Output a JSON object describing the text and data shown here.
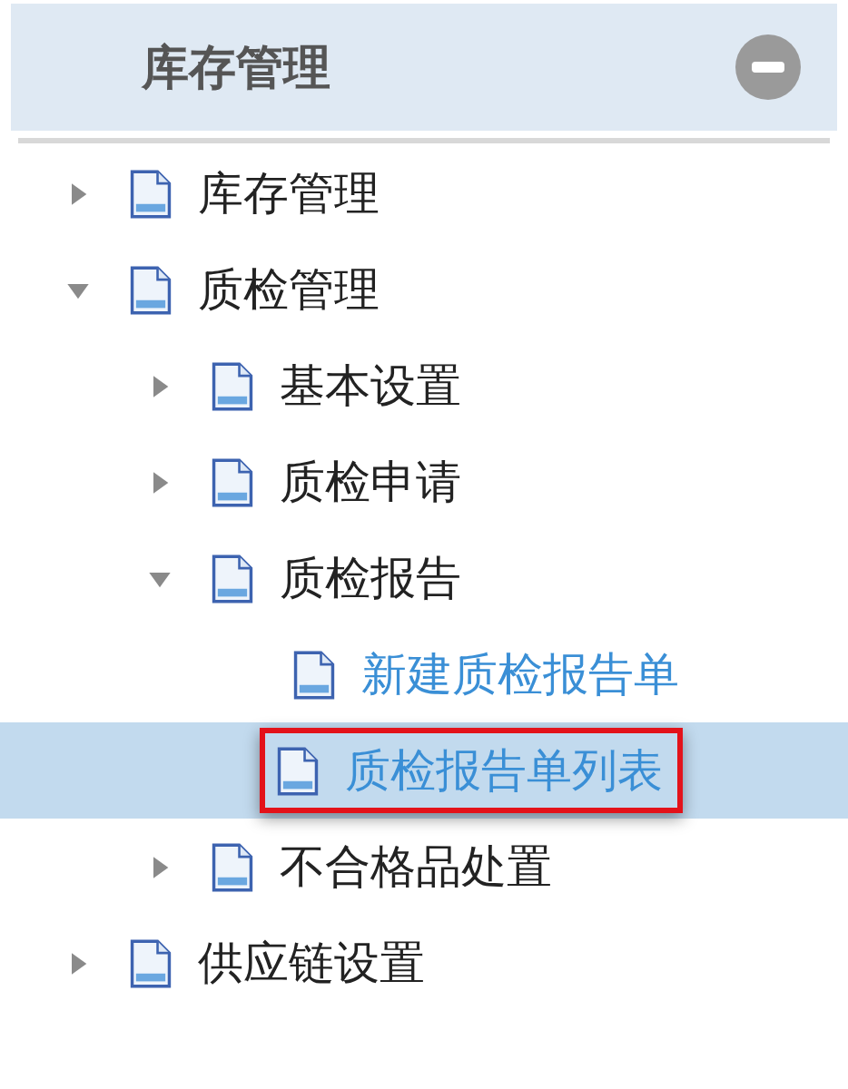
{
  "panel": {
    "title": "库存管理",
    "expanded": true
  },
  "tree": [
    {
      "label": "库存管理",
      "kind": "branch",
      "expanded": false,
      "selected": false
    },
    {
      "label": "质检管理",
      "kind": "branch",
      "expanded": true,
      "selected": false,
      "children": [
        {
          "label": "基本设置",
          "kind": "branch",
          "expanded": false,
          "selected": false
        },
        {
          "label": "质检申请",
          "kind": "branch",
          "expanded": false,
          "selected": false
        },
        {
          "label": "质检报告",
          "kind": "branch",
          "expanded": true,
          "selected": false,
          "children": [
            {
              "label": "新建质检报告单",
              "kind": "leaf",
              "selected": false
            },
            {
              "label": "质检报告单列表",
              "kind": "leaf",
              "selected": true
            }
          ]
        },
        {
          "label": "不合格品处置",
          "kind": "branch",
          "expanded": false,
          "selected": false
        }
      ]
    },
    {
      "label": "供应链设置",
      "kind": "branch",
      "expanded": false,
      "selected": false
    }
  ]
}
